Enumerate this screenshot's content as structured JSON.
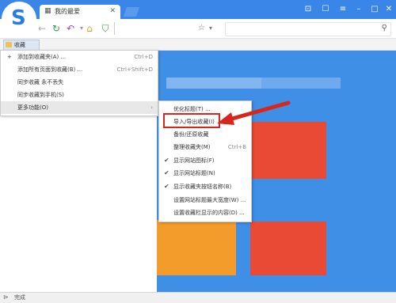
{
  "tab": {
    "title": "我的最爱"
  },
  "bookmark_bar": {
    "folder_label": "收藏"
  },
  "menu_main": [
    {
      "label": "添加到收藏夹(A) ...",
      "shortcut": "Ctrl+D",
      "icon": "plus-icon"
    },
    {
      "label": "添加所有页面到收藏(B) ...",
      "shortcut": "Ctrl+Shift+D",
      "icon": ""
    },
    {
      "label": "同步收藏 永不丢失",
      "shortcut": "",
      "icon": ""
    },
    {
      "label": "同步收藏到手机(S)",
      "shortcut": "",
      "icon": ""
    },
    {
      "label": "更多功能(O)",
      "shortcut": "›",
      "icon": ""
    }
  ],
  "menu_sub": [
    {
      "label": "优化标题(T) ...",
      "shortcut": "",
      "check": ""
    },
    {
      "label": "导入/导出收藏(I)",
      "shortcut": "",
      "check": ""
    },
    {
      "label": "备份/还原收藏",
      "shortcut": "",
      "check": ""
    },
    {
      "label": "整理收藏夹(M)",
      "shortcut": "Ctrl+B",
      "check": ""
    },
    {
      "label": "显示网站图标(F)",
      "shortcut": "",
      "check": "✔"
    },
    {
      "label": "显示网站标题(N)",
      "shortcut": "",
      "check": "✔"
    },
    {
      "label": "显示收藏夹按钮名称(B)",
      "shortcut": "",
      "check": "✔"
    },
    {
      "label": "设置网站标题最大宽度(W) ...",
      "shortcut": "",
      "check": ""
    },
    {
      "label": "设置收藏栏显示的内容(D) ...",
      "shortcut": "",
      "check": ""
    }
  ],
  "status": {
    "text": "完成"
  },
  "colors": {
    "accent_blue": "#3a86e8",
    "annotation_red": "#d9261c"
  }
}
